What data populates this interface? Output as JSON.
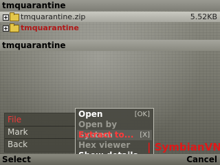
{
  "window": {
    "title": "tmquarantine"
  },
  "list": {
    "items": [
      {
        "expander": "+",
        "label": "tmquarantine.zip",
        "size": "5.52KB"
      },
      {
        "expander": "+",
        "label": "tmquarantine",
        "size": ""
      }
    ],
    "section_title": "tmquarantine"
  },
  "left_menu": {
    "items": [
      {
        "label": "File"
      },
      {
        "label": "Mark"
      },
      {
        "label": "Back"
      }
    ]
  },
  "submenu": {
    "items": [
      {
        "label": "Open",
        "shortcut": "[OK]"
      },
      {
        "label": "Open by System",
        "shortcut": ""
      },
      {
        "label": "Extract to...",
        "shortcut": "[X]"
      },
      {
        "label": "Hex viewer",
        "shortcut": ""
      },
      {
        "label": "Show details",
        "shortcut": ""
      }
    ]
  },
  "watermark": {
    "text": "| SymbianVN |"
  },
  "softkeys": {
    "left": "Select",
    "right": "Cancel"
  },
  "colors": {
    "highlight_red": "#ff3a3a",
    "folder_red": "#b01818",
    "menu_bg": "#4a4a42"
  }
}
